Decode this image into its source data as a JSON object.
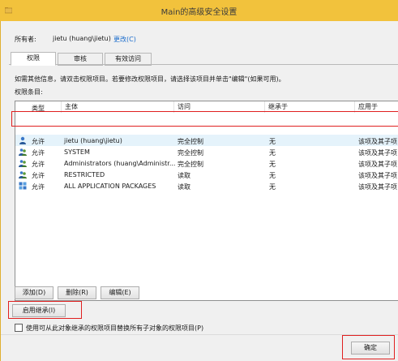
{
  "window": {
    "title": "Main的高级安全设置"
  },
  "owner": {
    "label": "所有者:",
    "value": "jietu (huang\\jietu)",
    "change_link": "更改(C)"
  },
  "tabs": [
    {
      "label": "权限",
      "active": true
    },
    {
      "label": "审核",
      "active": false
    },
    {
      "label": "有效访问",
      "active": false
    }
  ],
  "info_text": "如需其他信息，请双击权限项目。若要修改权限项目，请选择该项目并单击\"编辑\"(如果可用)。",
  "list_label": "权限条目:",
  "table": {
    "headers": [
      "类型",
      "主体",
      "访问",
      "继承于",
      "应用于"
    ],
    "rows": [
      {
        "icon": "user-icon",
        "type": "允许",
        "principal": "jietu (huang\\jietu)",
        "access": "完全控制",
        "inherited": "无",
        "applies": "该项及其子项"
      },
      {
        "icon": "group-icon",
        "type": "允许",
        "principal": "SYSTEM",
        "access": "完全控制",
        "inherited": "无",
        "applies": "该项及其子项"
      },
      {
        "icon": "group-icon",
        "type": "允许",
        "principal": "Administrators (huang\\Administr...",
        "access": "完全控制",
        "inherited": "无",
        "applies": "该项及其子项"
      },
      {
        "icon": "group-icon",
        "type": "允许",
        "principal": "RESTRICTED",
        "access": "读取",
        "inherited": "无",
        "applies": "该项及其子项"
      },
      {
        "icon": "package-icon",
        "type": "允许",
        "principal": "ALL APPLICATION PACKAGES",
        "access": "读取",
        "inherited": "无",
        "applies": "该项及其子项"
      }
    ]
  },
  "buttons": {
    "add": "添加(D)",
    "remove": "删除(R)",
    "edit": "编辑(E)",
    "enable_inheritance": "启用继承(I)",
    "ok": "确定"
  },
  "replace_checkbox": {
    "label": "使用可从此对象继承的权限项目替换所有子对象的权限项目(P)",
    "checked": false
  },
  "colors": {
    "titlebar": "#f2c23c",
    "link": "#1a6ccc",
    "highlight": "#e02020",
    "selected_row": "#e5f3fb"
  }
}
